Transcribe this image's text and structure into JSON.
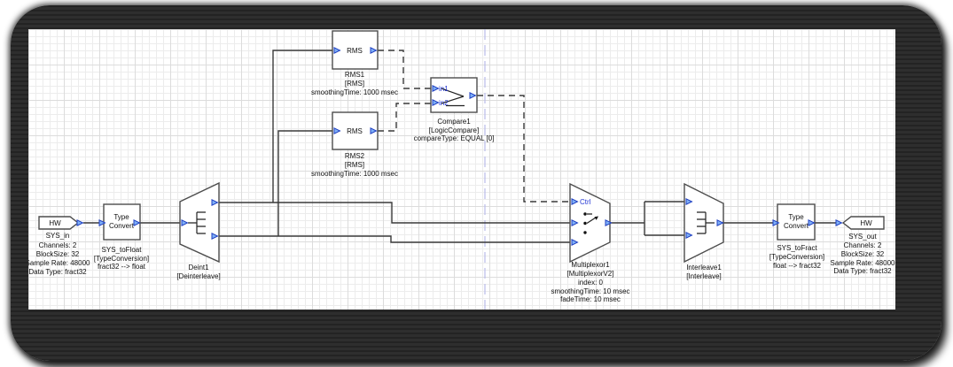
{
  "theme": {
    "accent": "#2336d4",
    "wire": "#3a3a3a",
    "block-border": "#4c4c4c",
    "grid-minor": "#ececec",
    "grid-major": "#dcdcdc",
    "page-line": "#b9bce8",
    "frame": "#2a2a2a",
    "canvas-bg": "#ffffff"
  },
  "blocks": {
    "sys_in": {
      "title": "HW",
      "name": "SYS_in",
      "props": [
        "Channels: 2",
        "BlockSize: 32",
        "Sample Rate: 48000",
        "Data Type: fract32"
      ]
    },
    "type_convert_in": {
      "title_line1": "Type",
      "title_line2": "Convert",
      "name": "SYS_toFloat",
      "type": "[TypeConversion]",
      "conversion": "fract32 --> float"
    },
    "deint": {
      "icon": "deinterleave-comb-icon",
      "name": "Deint1",
      "type": "[Deinterleave]"
    },
    "rms1": {
      "title": "RMS",
      "name": "RMS1",
      "type": "[RMS]",
      "props": [
        "smoothingTime: 1000 msec"
      ]
    },
    "rms2": {
      "title": "RMS",
      "name": "RMS2",
      "type": "[RMS]",
      "props": [
        "smoothingTime: 1000 msec"
      ]
    },
    "compare": {
      "icon": "comparator-icon",
      "pin_in1": "in1",
      "pin_in2": "in2",
      "name": "Compare1",
      "type": "[LogicCompare]",
      "props": [
        "compareType: EQUAL [0]"
      ]
    },
    "mux": {
      "icon": "switch-icon",
      "pin_ctrl": "Ctrl",
      "name": "Multiplexor1",
      "type": "[MultiplexorV2]",
      "props": [
        "index: 0",
        "smoothingTime: 10 msec",
        "fadeTime: 10 msec"
      ]
    },
    "interleave": {
      "icon": "interleave-comb-icon",
      "name": "Interleave1",
      "type": "[Interleave]"
    },
    "type_convert_out": {
      "title_line1": "Type",
      "title_line2": "Convert",
      "name": "SYS_toFract",
      "type": "[TypeConversion]",
      "conversion": "float --> fract32"
    },
    "sys_out": {
      "title": "HW",
      "name": "SYS_out",
      "props": [
        "Channels: 2",
        "BlockSize: 32",
        "Sample Rate: 48000",
        "Data Type: fract32"
      ]
    }
  }
}
